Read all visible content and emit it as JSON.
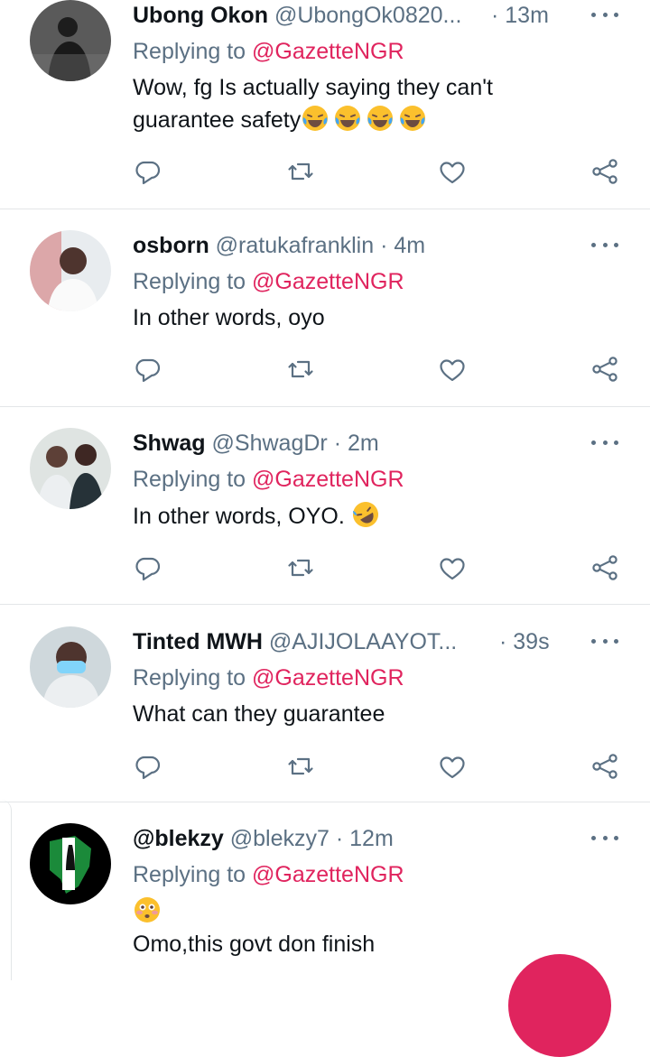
{
  "reply_prefix": "Replying to",
  "colors": {
    "accent": "#e0245e",
    "secondary_text": "#5b7083",
    "primary_text": "#0f1419",
    "divider": "#e3e6e8"
  },
  "tweets": [
    {
      "name": "Ubong Okon",
      "handle": "@UbongOk0820...",
      "time": "· 13m",
      "reply_to": "@GazetteNGR",
      "text_lines": [
        "Wow, fg Is actually saying they can't",
        "guarantee safety"
      ],
      "emojis": [
        "face-with-tears-of-joy",
        "face-with-tears-of-joy",
        "face-with-tears-of-joy",
        "face-with-tears-of-joy"
      ]
    },
    {
      "name": "osborn",
      "handle": "@ratukafranklin",
      "time": "· 4m",
      "reply_to": "@GazetteNGR",
      "text_lines": [
        "In other words, oyo"
      ]
    },
    {
      "name": "Shwag",
      "handle": "@ShwagDr",
      "time": "· 2m",
      "reply_to": "@GazetteNGR",
      "text_lines": [
        "In other words, OYO."
      ],
      "emojis": [
        "rolling-on-floor-laughing"
      ]
    },
    {
      "name": "Tinted MWH",
      "handle": "@AJIJOLAAYOT...",
      "time": "· 39s",
      "reply_to": "@GazetteNGR",
      "text_lines": [
        "What can they guarantee"
      ]
    },
    {
      "name": "@blekzy",
      "handle": "@blekzy7",
      "time": "· 12m",
      "reply_to": "@GazetteNGR",
      "emojis": [
        "flushed-face"
      ],
      "text_lines": [
        "Omo,this govt don finish"
      ]
    }
  ]
}
